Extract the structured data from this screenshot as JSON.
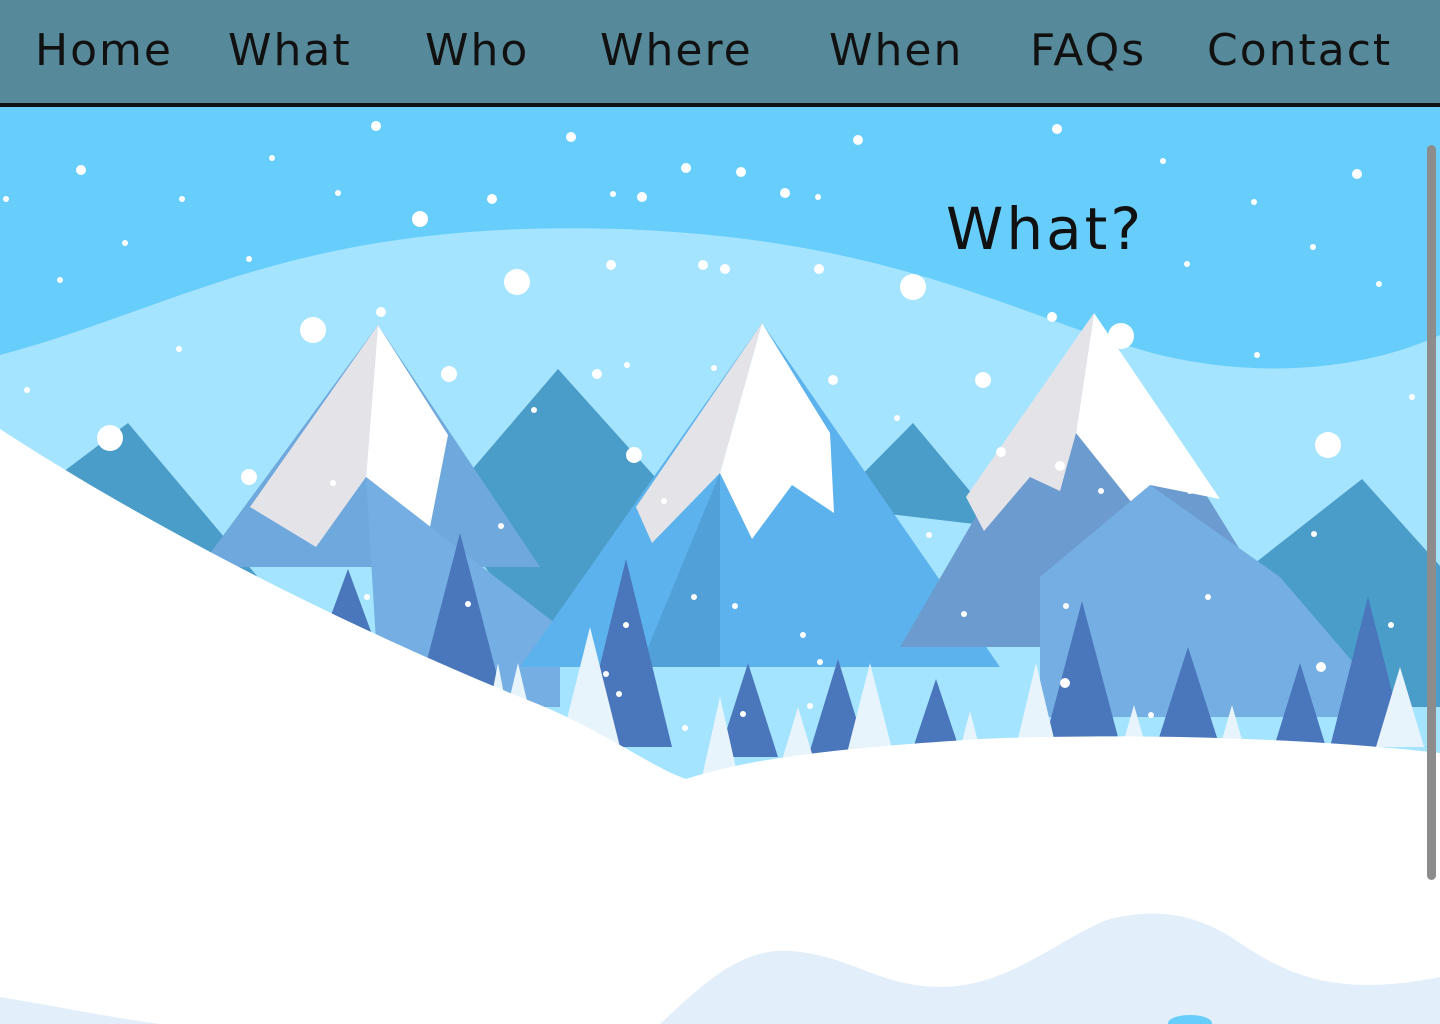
{
  "nav": {
    "items": [
      {
        "id": "home",
        "label": "Home"
      },
      {
        "id": "what",
        "label": "What"
      },
      {
        "id": "who",
        "label": "Who"
      },
      {
        "id": "where",
        "label": "Where"
      },
      {
        "id": "when",
        "label": "When"
      },
      {
        "id": "faqs",
        "label": "FAQs"
      },
      {
        "id": "contact",
        "label": "Contact"
      }
    ]
  },
  "section": {
    "title": "What?"
  },
  "colors": {
    "nav_bg": "#568a9a",
    "sky": "#67cefb",
    "sky_band": "#a5e4fe",
    "snow": "#ffffff",
    "mountain_dark": "#4a9cc9",
    "mountain_mid": "#6ea8dc",
    "tree": "#4a76bb"
  }
}
